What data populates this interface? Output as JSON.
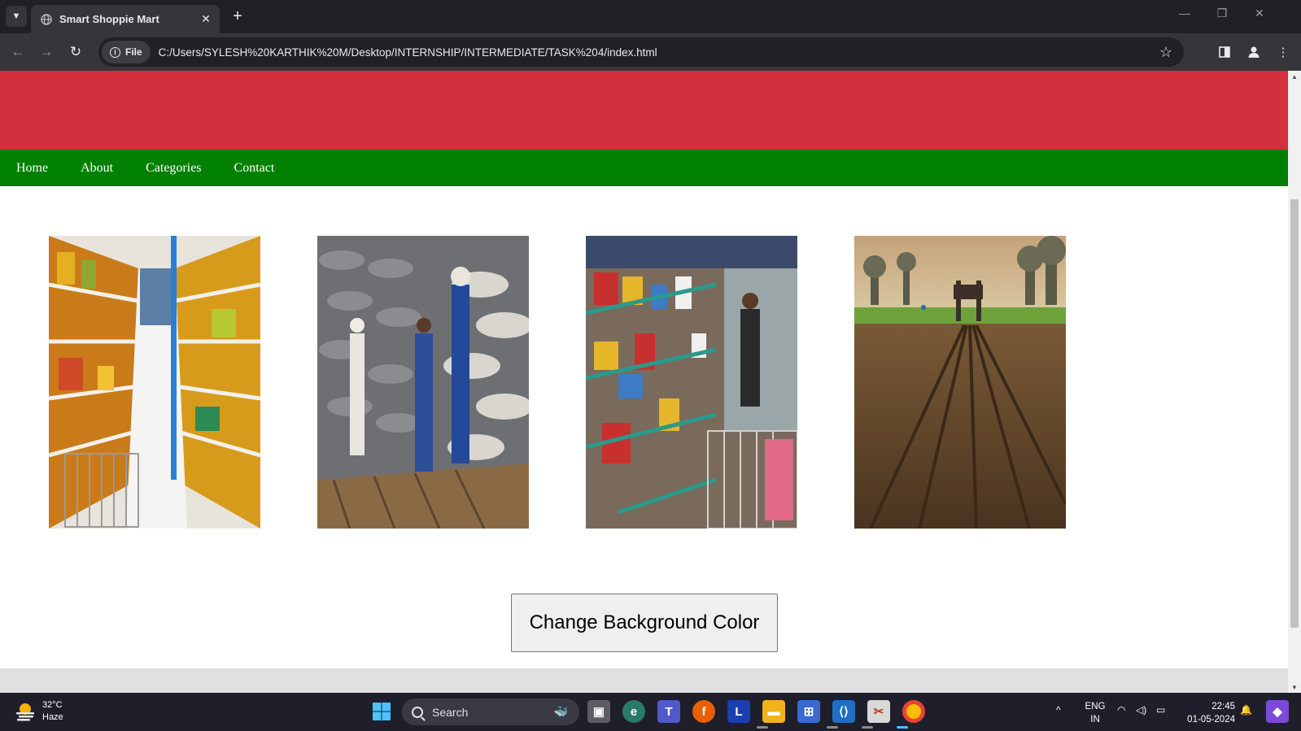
{
  "browser": {
    "tab_title": "Smart Shoppie Mart",
    "tab_close": "✕",
    "new_tab": "+",
    "chip_label": "File",
    "url": "C:/Users/SYLESH%20KARTHIK%20M/Desktop/INTERNSHIP/INTERMEDIATE/TASK%204/index.html"
  },
  "site": {
    "header_color": "#d32f3c",
    "nav_color": "#008000",
    "nav": [
      "Home",
      "About",
      "Categories",
      "Contact"
    ],
    "gallery": [
      {
        "icon": "supermarket-aisle-image"
      },
      {
        "icon": "warehouse-sacks-image"
      },
      {
        "icon": "grocery-shelves-image"
      },
      {
        "icon": "farm-field-image"
      }
    ],
    "button_label": "Change Background Color"
  },
  "taskbar": {
    "weather_temp": "32°C",
    "weather_desc": "Haze",
    "search_label": "Search",
    "lang_line1": "ENG",
    "lang_line2": "IN",
    "time": "22:45",
    "date": "01-05-2024"
  }
}
